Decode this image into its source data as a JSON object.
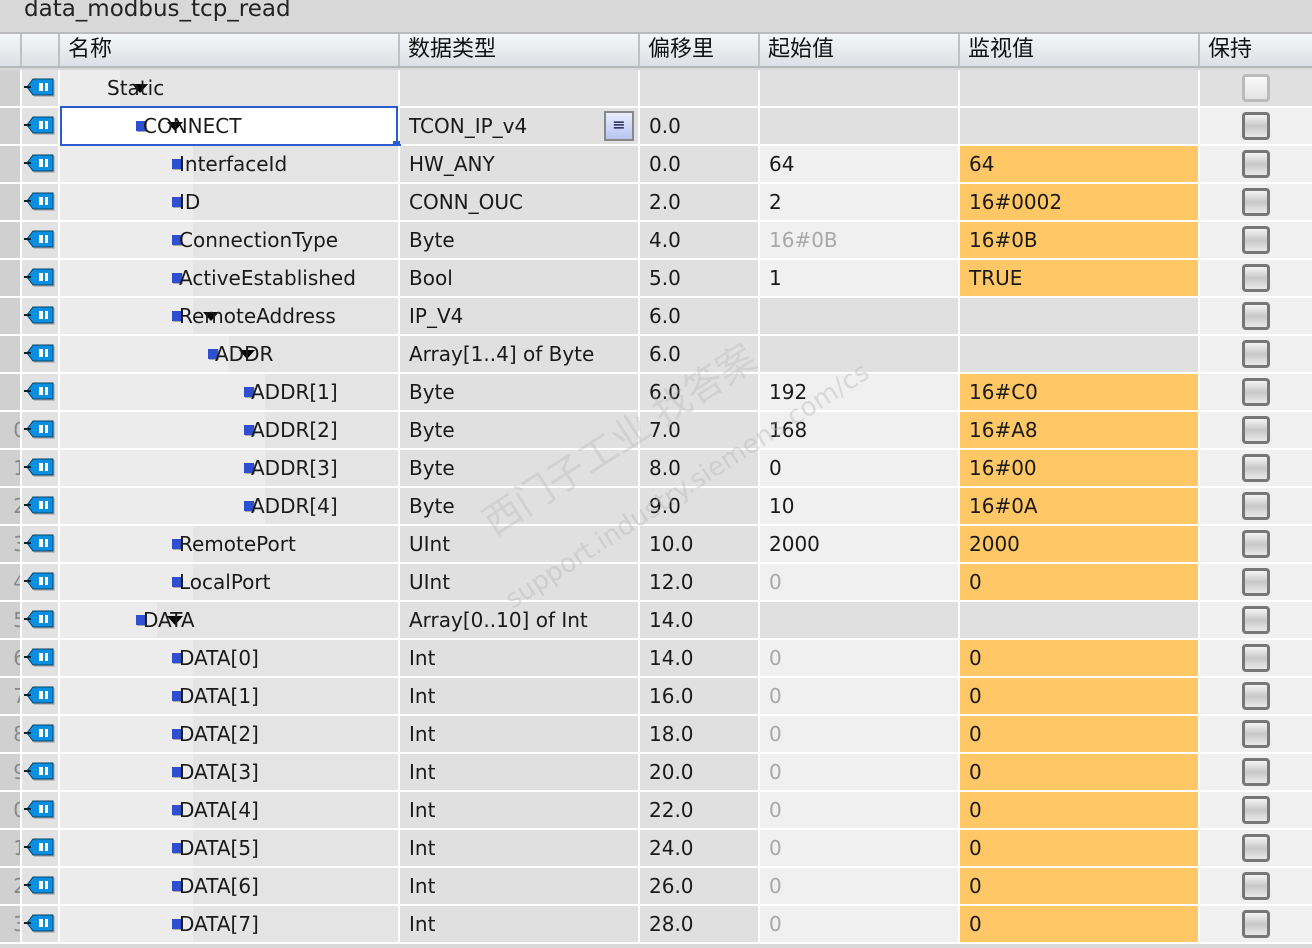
{
  "title": "data_modbus_tcp_read",
  "headers": {
    "name": "名称",
    "type": "数据类型",
    "offset": "偏移里",
    "start": "起始值",
    "monitor": "监视值",
    "retain": "保持"
  },
  "colors": {
    "monitor_bg": "#ffc766",
    "selection": "#2a5ecf",
    "icon": "#0a8ee0"
  },
  "watermark": {
    "line1": "西门子工业 找答案",
    "line2": "support.industry.siemens.com/cs"
  },
  "rows": [
    {
      "rn": "",
      "level": 0,
      "expand": true,
      "bullet": false,
      "name": "Static",
      "type": "",
      "offset": "",
      "start": "",
      "start_grey": false,
      "monitor": "",
      "retain_light": true
    },
    {
      "rn": "",
      "level": 1,
      "expand": true,
      "bullet": true,
      "name": "CONNECT",
      "type": "TCON_IP_v4",
      "offset": "0.0",
      "start": "",
      "start_grey": false,
      "monitor": "",
      "selected": true
    },
    {
      "rn": "",
      "level": 2,
      "expand": false,
      "bullet": true,
      "name": "InterfaceId",
      "type": "HW_ANY",
      "offset": "0.0",
      "start": "64",
      "start_grey": false,
      "monitor": "64"
    },
    {
      "rn": "",
      "level": 2,
      "expand": false,
      "bullet": true,
      "name": "ID",
      "type": "CONN_OUC",
      "offset": "2.0",
      "start": "2",
      "start_grey": false,
      "monitor": "16#0002"
    },
    {
      "rn": "",
      "level": 2,
      "expand": false,
      "bullet": true,
      "name": "ConnectionType",
      "type": "Byte",
      "offset": "4.0",
      "start": "16#0B",
      "start_grey": true,
      "monitor": "16#0B"
    },
    {
      "rn": "",
      "level": 2,
      "expand": false,
      "bullet": true,
      "name": "ActiveEstablished",
      "type": "Bool",
      "offset": "5.0",
      "start": "1",
      "start_grey": false,
      "monitor": "TRUE"
    },
    {
      "rn": "",
      "level": 2,
      "expand": true,
      "bullet": true,
      "name": "RemoteAddress",
      "type": "IP_V4",
      "offset": "6.0",
      "start": "",
      "start_grey": false,
      "monitor": ""
    },
    {
      "rn": "",
      "level": 3,
      "expand": true,
      "bullet": true,
      "name": "ADDR",
      "type": "Array[1..4] of Byte",
      "offset": "6.0",
      "start": "",
      "start_grey": false,
      "monitor": ""
    },
    {
      "rn": "",
      "level": 4,
      "expand": false,
      "bullet": true,
      "name": "ADDR[1]",
      "type": "Byte",
      "offset": "6.0",
      "start": "192",
      "start_grey": false,
      "monitor": "16#C0"
    },
    {
      "rn": "0",
      "level": 4,
      "expand": false,
      "bullet": true,
      "name": "ADDR[2]",
      "type": "Byte",
      "offset": "7.0",
      "start": "168",
      "start_grey": false,
      "monitor": "16#A8"
    },
    {
      "rn": "1",
      "level": 4,
      "expand": false,
      "bullet": true,
      "name": "ADDR[3]",
      "type": "Byte",
      "offset": "8.0",
      "start": "0",
      "start_grey": false,
      "monitor": "16#00"
    },
    {
      "rn": "2",
      "level": 4,
      "expand": false,
      "bullet": true,
      "name": "ADDR[4]",
      "type": "Byte",
      "offset": "9.0",
      "start": "10",
      "start_grey": false,
      "monitor": "16#0A"
    },
    {
      "rn": "3",
      "level": 2,
      "expand": false,
      "bullet": true,
      "name": "RemotePort",
      "type": "UInt",
      "offset": "10.0",
      "start": "2000",
      "start_grey": false,
      "monitor": "2000"
    },
    {
      "rn": "4",
      "level": 2,
      "expand": false,
      "bullet": true,
      "name": "LocalPort",
      "type": "UInt",
      "offset": "12.0",
      "start": "0",
      "start_grey": true,
      "monitor": "0"
    },
    {
      "rn": "5",
      "level": 1,
      "expand": true,
      "bullet": true,
      "name": "DATA",
      "type": "Array[0..10] of Int",
      "offset": "14.0",
      "start": "",
      "start_grey": false,
      "monitor": ""
    },
    {
      "rn": "6",
      "level": 2,
      "expand": false,
      "bullet": true,
      "name": "DATA[0]",
      "type": "Int",
      "offset": "14.0",
      "start": "0",
      "start_grey": true,
      "monitor": "0"
    },
    {
      "rn": "7",
      "level": 2,
      "expand": false,
      "bullet": true,
      "name": "DATA[1]",
      "type": "Int",
      "offset": "16.0",
      "start": "0",
      "start_grey": true,
      "monitor": "0"
    },
    {
      "rn": "8",
      "level": 2,
      "expand": false,
      "bullet": true,
      "name": "DATA[2]",
      "type": "Int",
      "offset": "18.0",
      "start": "0",
      "start_grey": true,
      "monitor": "0"
    },
    {
      "rn": "9",
      "level": 2,
      "expand": false,
      "bullet": true,
      "name": "DATA[3]",
      "type": "Int",
      "offset": "20.0",
      "start": "0",
      "start_grey": true,
      "monitor": "0"
    },
    {
      "rn": "0",
      "level": 2,
      "expand": false,
      "bullet": true,
      "name": "DATA[4]",
      "type": "Int",
      "offset": "22.0",
      "start": "0",
      "start_grey": true,
      "monitor": "0"
    },
    {
      "rn": "1",
      "level": 2,
      "expand": false,
      "bullet": true,
      "name": "DATA[5]",
      "type": "Int",
      "offset": "24.0",
      "start": "0",
      "start_grey": true,
      "monitor": "0"
    },
    {
      "rn": "2",
      "level": 2,
      "expand": false,
      "bullet": true,
      "name": "DATA[6]",
      "type": "Int",
      "offset": "26.0",
      "start": "0",
      "start_grey": true,
      "monitor": "0"
    },
    {
      "rn": "3",
      "level": 2,
      "expand": false,
      "bullet": true,
      "name": "DATA[7]",
      "type": "Int",
      "offset": "28.0",
      "start": "0",
      "start_grey": true,
      "monitor": "0"
    }
  ]
}
